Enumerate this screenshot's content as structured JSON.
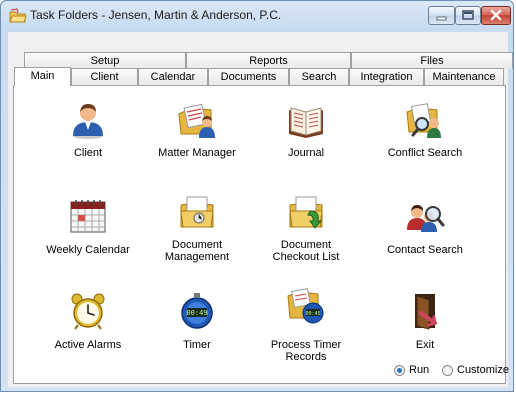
{
  "window": {
    "title": "Task Folders - Jensen, Martin & Anderson, P.C.",
    "controls": {
      "minimize": "minimize",
      "maximize": "maximize",
      "close": "close"
    }
  },
  "tabs_back": [
    "Setup",
    "Reports",
    "Files"
  ],
  "tabs_front": [
    "Main",
    "Client",
    "Calendar",
    "Documents",
    "Search",
    "Integration",
    "Maintenance"
  ],
  "active_tab": "Main",
  "items": [
    {
      "label": "Client",
      "icon": "person-icon"
    },
    {
      "label": "Matter Manager",
      "icon": "folder-person-icon"
    },
    {
      "label": "Journal",
      "icon": "book-icon"
    },
    {
      "label": "Conflict Search",
      "icon": "folder-search-icon"
    },
    {
      "label": "Weekly Calendar",
      "icon": "calendar-icon"
    },
    {
      "label": "Document\nManagement",
      "icon": "document-folder-icon"
    },
    {
      "label": "Document\nCheckout List",
      "icon": "checkout-icon"
    },
    {
      "label": "Contact Search",
      "icon": "contacts-search-icon"
    },
    {
      "label": "Active Alarms",
      "icon": "alarm-clock-icon"
    },
    {
      "label": "Timer",
      "icon": "stopwatch-icon"
    },
    {
      "label": "Process Timer\nRecords",
      "icon": "timer-records-icon"
    },
    {
      "label": "Exit",
      "icon": "exit-door-icon"
    }
  ],
  "mode": {
    "run_label": "Run",
    "customize_label": "Customize",
    "selected": "Run"
  }
}
